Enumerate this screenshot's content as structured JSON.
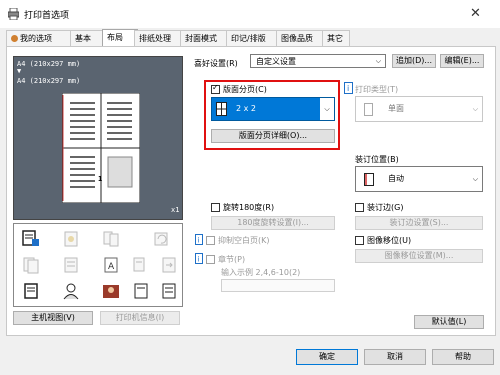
{
  "window": {
    "title": "打印首选项",
    "close_glyph": "✕"
  },
  "tabs": [
    {
      "label": "我的选项"
    },
    {
      "label": "基本"
    },
    {
      "label": "布局"
    },
    {
      "label": "排纸处理"
    },
    {
      "label": "封面模式"
    },
    {
      "label": "印记/排版"
    },
    {
      "label": "图像品质"
    },
    {
      "label": "其它"
    }
  ],
  "preview": {
    "line1": "A4 (210x297 mm)",
    "line2": "A4 (210x297 mm)",
    "arrow": "▼",
    "zoom": "x1",
    "page_number": "1"
  },
  "left_buttons": {
    "main_view": "主机视图(V)",
    "printer_info": "打印机信息(I)"
  },
  "favorites": {
    "label": "喜好设置(R)",
    "value": "自定义设置",
    "add": "追加(D)...",
    "edit": "编辑(E)..."
  },
  "combine": {
    "label": "版面分页(C)",
    "value": "2 x 2",
    "details": "版面分页详细(O)..."
  },
  "print_type": {
    "label": "打印类型(T)",
    "value": "单面"
  },
  "binding_position": {
    "label": "装订位置(B)",
    "value": "自动"
  },
  "rotate180": {
    "label": "旋转180度(R)",
    "settings": "180度旋转设置(I)..."
  },
  "skip_blank": {
    "label": "抑制空白页(K)"
  },
  "chapters": {
    "label": "章节(P)",
    "example": "输入示例 2,4,6-10(2)"
  },
  "binding_margin": {
    "label": "装订边(G)",
    "settings": "装订边设置(S)..."
  },
  "image_shift": {
    "label": "图像移位(U)",
    "settings": "图像移位设置(M)..."
  },
  "defaults_button": "默认值(L)",
  "bottom": {
    "ok": "确定",
    "cancel": "取消",
    "help": "帮助"
  },
  "colors": {
    "accent": "#0078d7",
    "highlight": "#e01010"
  }
}
